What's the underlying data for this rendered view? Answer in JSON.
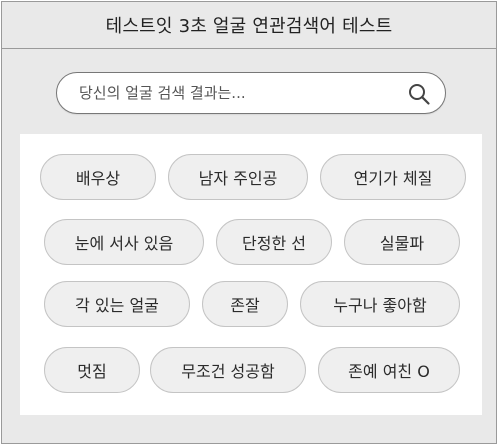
{
  "header": {
    "title": "테스트잇 3초 얼굴 연관검색어 테스트"
  },
  "search": {
    "text": "당신의 얼굴 검색 결과는...",
    "icon": "search-icon"
  },
  "results": {
    "tags": [
      "배우상",
      "남자 주인공",
      "연기가 체질",
      "눈에 서사 있음",
      "단정한 선",
      "실물파",
      "각 있는 얼굴",
      "존잘",
      "누구나 좋아함",
      "멋짐",
      "무조건 성공함",
      "존예 여친 O"
    ]
  },
  "colors": {
    "frame_bg": "#e9e9e9",
    "panel_bg": "#ffffff",
    "tag_bg": "#efefef",
    "tag_border": "#c4c4c4"
  }
}
